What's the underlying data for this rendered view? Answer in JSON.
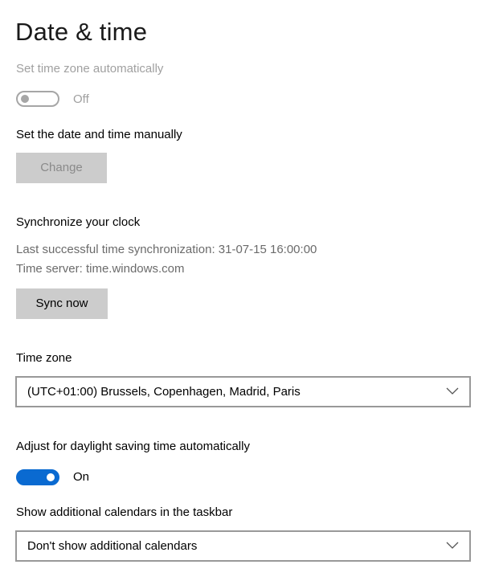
{
  "page": {
    "title": "Date & time"
  },
  "auto_timezone": {
    "label": "Set time zone automatically",
    "state": "Off",
    "enabled": false
  },
  "manual": {
    "label": "Set the date and time manually",
    "button": "Change"
  },
  "sync": {
    "heading": "Synchronize your clock",
    "last_sync": "Last successful time synchronization: 31-07-15 16:00:00",
    "server": "Time server: time.windows.com",
    "button": "Sync now"
  },
  "timezone": {
    "label": "Time zone",
    "value": "(UTC+01:00) Brussels, Copenhagen, Madrid, Paris"
  },
  "dst": {
    "label": "Adjust for daylight saving time automatically",
    "state": "On",
    "enabled": true
  },
  "calendars": {
    "label": "Show additional calendars in the taskbar",
    "value": "Don't show additional calendars"
  },
  "colors": {
    "accent": "#0a6ad1",
    "disabled_text": "#a0a0a0",
    "button_bg": "#cccccc"
  },
  "icons": {
    "dropdown": "chevron-down-icon"
  }
}
